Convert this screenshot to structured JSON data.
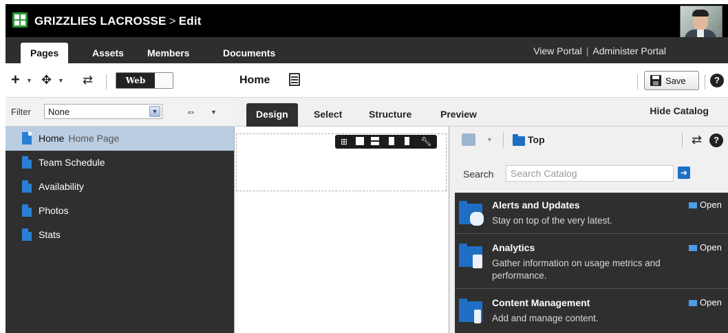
{
  "banner": {
    "app_name": "GRIZZLIES LACROSSE",
    "separator": ">",
    "mode": "Edit"
  },
  "nav": {
    "tabs": [
      "Pages",
      "Assets",
      "Members",
      "Documents"
    ],
    "active_tab": "Pages",
    "view_portal": "View Portal",
    "pipe": "|",
    "administer_portal": "Administer Portal"
  },
  "toolbar": {
    "view_mode": "Web",
    "page_name": "Home",
    "save_label": "Save",
    "help": "?"
  },
  "filter": {
    "label": "Filter",
    "value": "None"
  },
  "pages": [
    {
      "name": "Home",
      "subtitle": "Home Page",
      "selected": true
    },
    {
      "name": "Team Schedule",
      "subtitle": "",
      "selected": false
    },
    {
      "name": "Availability",
      "subtitle": "",
      "selected": false
    },
    {
      "name": "Photos",
      "subtitle": "",
      "selected": false
    },
    {
      "name": "Stats",
      "subtitle": "",
      "selected": false
    }
  ],
  "design_tabs": {
    "tabs": [
      "Design",
      "Select",
      "Structure",
      "Preview"
    ],
    "active_tab": "Design",
    "hide_catalog": "Hide Catalog"
  },
  "catalog": {
    "location": "Top",
    "help": "?",
    "search_label": "Search",
    "search_placeholder": "Search Catalog",
    "items": [
      {
        "title": "Alerts and Updates",
        "description": "Stay on top of the very latest.",
        "open_label": "Open",
        "icon": "alerts-icon"
      },
      {
        "title": "Analytics",
        "description": "Gather information on usage metrics and performance.",
        "open_label": "Open",
        "icon": "analytics-icon"
      },
      {
        "title": "Content Management",
        "description": "Add and manage content.",
        "open_label": "Open",
        "icon": "content-icon"
      }
    ]
  },
  "colors": {
    "banner": "#000000",
    "nav": "#2e2e2e",
    "panel": "#2f2f2f",
    "selected_row": "#b9cde3",
    "accent_blue": "#1e6fc4",
    "logo_green": "#2a9a3a"
  }
}
